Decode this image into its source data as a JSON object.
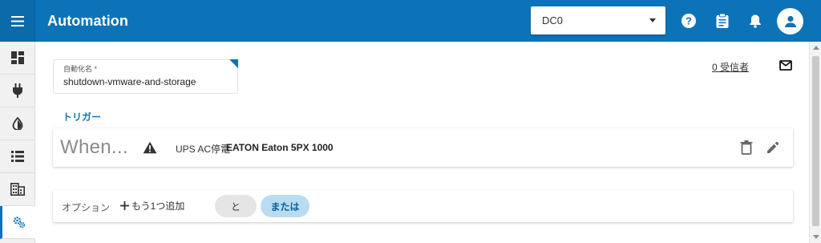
{
  "header": {
    "title": "Automation",
    "site_select": {
      "value": "DC0"
    },
    "icons": [
      "menu-icon",
      "help-icon",
      "clipboard-icon",
      "bell-icon",
      "account-icon"
    ]
  },
  "sidebar": {
    "items": [
      {
        "icon": "dashboard-icon"
      },
      {
        "icon": "power-plug-icon"
      },
      {
        "icon": "contrast-icon"
      },
      {
        "icon": "list-icon"
      },
      {
        "icon": "building-icon"
      },
      {
        "icon": "automation-gears-icon",
        "active": true
      }
    ]
  },
  "form": {
    "name_label": "自動化名 *",
    "name_value": "shutdown-vmware-and-storage",
    "recipients_link": "0 受信者",
    "trigger_section_title": "トリガー"
  },
  "trigger": {
    "when_text": "When...",
    "prefix": "UPS AC停電",
    "device": "EATON Eaton 5PX 1000"
  },
  "options": {
    "label": "オプション",
    "add_one_label": "もう1つ追加",
    "and_label": "と",
    "or_label": "または"
  },
  "colors": {
    "primary": "#0d73b8",
    "chip_selected_bg": "#b9dcf3",
    "chip_bg": "#e5e5e5"
  }
}
